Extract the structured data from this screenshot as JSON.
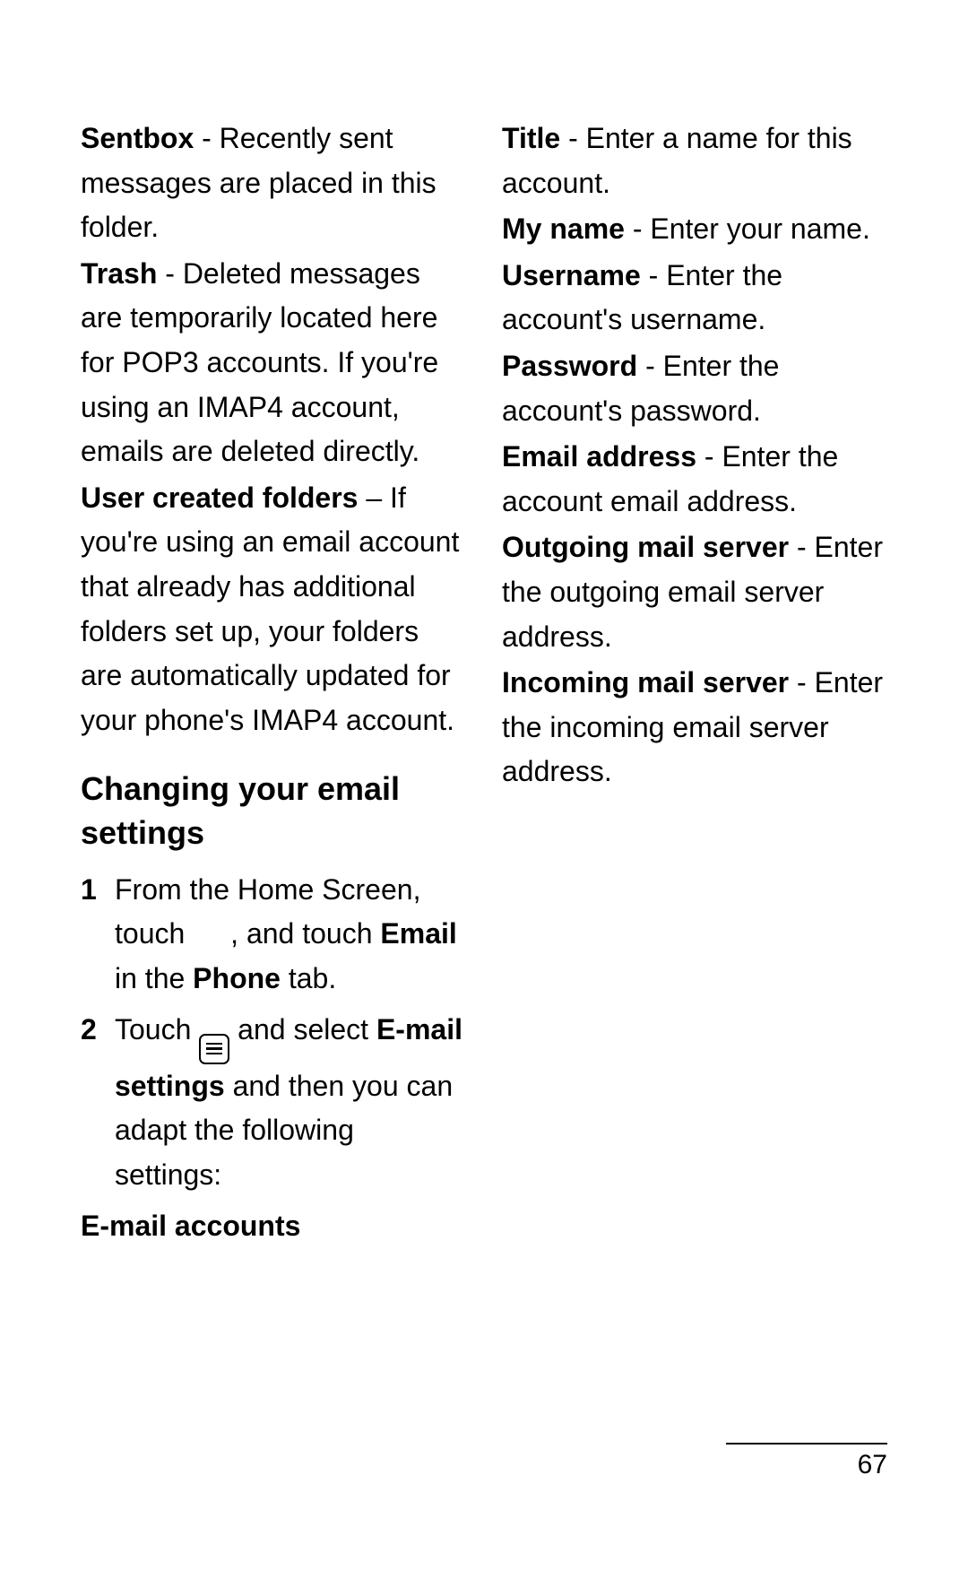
{
  "page_number": "67",
  "entries": {
    "sentbox_term": "Sentbox",
    "sentbox_desc": " - Recently sent messages are placed in this folder.",
    "trash_term": "Trash",
    "trash_desc": " - Deleted messages are temporarily located here for POP3 accounts. If you're using an IMAP4 account, emails are deleted directly.",
    "user_folders_term": "User created folders",
    "user_folders_desc": " – If you're using an email account that already has additional folders set up, your folders are automatically updated for your phone's IMAP4 account."
  },
  "heading": "Changing your email settings",
  "steps": {
    "s1_a": "From the Home Screen, touch ",
    "s1_b": ", and touch ",
    "s1_email": "Email",
    "s1_c": " in the ",
    "s1_phone": "Phone",
    "s1_d": " tab.",
    "s2_a": "Touch ",
    "s2_b": " and select ",
    "s2_label": "E-mail settings",
    "s2_c": " and then you can adapt the following settings:"
  },
  "settings": {
    "accounts_header": "E-mail accounts",
    "title_term": "Title",
    "title_desc": " - Enter a name for this account.",
    "myname_term": "My name",
    "myname_desc": " - Enter your name.",
    "username_term": "Username",
    "username_desc": " - Enter the account's username.",
    "password_term": "Password",
    "password_desc": " - Enter the account's password.",
    "email_term": "Email address",
    "email_desc": " - Enter the account email address.",
    "outgoing_term": "Outgoing mail server",
    "outgoing_desc": " - Enter the outgoing email server address.",
    "incoming_term": "Incoming mail server",
    "incoming_desc": " - Enter the incoming email server address."
  }
}
